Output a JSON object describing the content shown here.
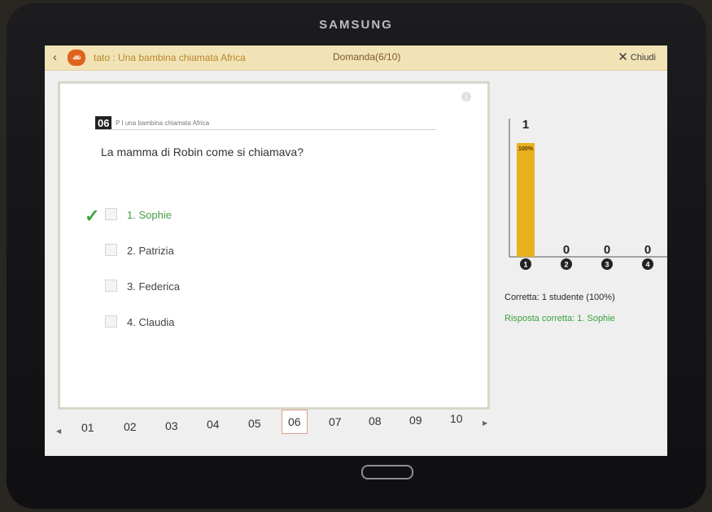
{
  "device": {
    "brand": "SAMSUNG"
  },
  "header": {
    "title": "tato : Una bambina chiamata Africa",
    "question_counter": "Domanda(6/10)",
    "close_label": "Chiudi",
    "app_icon_text": "ക്ക"
  },
  "question": {
    "number": "06",
    "source": "P I una bambina chiamata Africa",
    "text": "La mamma di Robin come si chiamava?",
    "options": [
      {
        "label": "1.  Sophie",
        "correct": true
      },
      {
        "label": "2.  Patrizia",
        "correct": false
      },
      {
        "label": "3.  Federica",
        "correct": false
      },
      {
        "label": "4.  Claudia",
        "correct": false
      }
    ]
  },
  "pagination": {
    "pages": [
      "01",
      "02",
      "03",
      "04",
      "05",
      "06",
      "07",
      "08",
      "09",
      "10"
    ],
    "current": "06"
  },
  "results": {
    "correct_count": "Corretta: 1 studente (100%)",
    "correct_answer": "Risposta corretta: 1. Sophie"
  },
  "chart_data": {
    "type": "bar",
    "categories": [
      "1",
      "2",
      "3",
      "4"
    ],
    "values": [
      1,
      0,
      0,
      0
    ],
    "bar_labels": [
      "1",
      "0",
      "0",
      "0"
    ],
    "percent_labels": [
      "100%",
      "",
      "",
      ""
    ],
    "ylim": [
      0,
      1
    ],
    "color": "#e8b11f"
  },
  "colors": {
    "accent_bar": "#e8b11f",
    "correct_green": "#3fa43a",
    "header_bg": "#f2e3b6"
  }
}
